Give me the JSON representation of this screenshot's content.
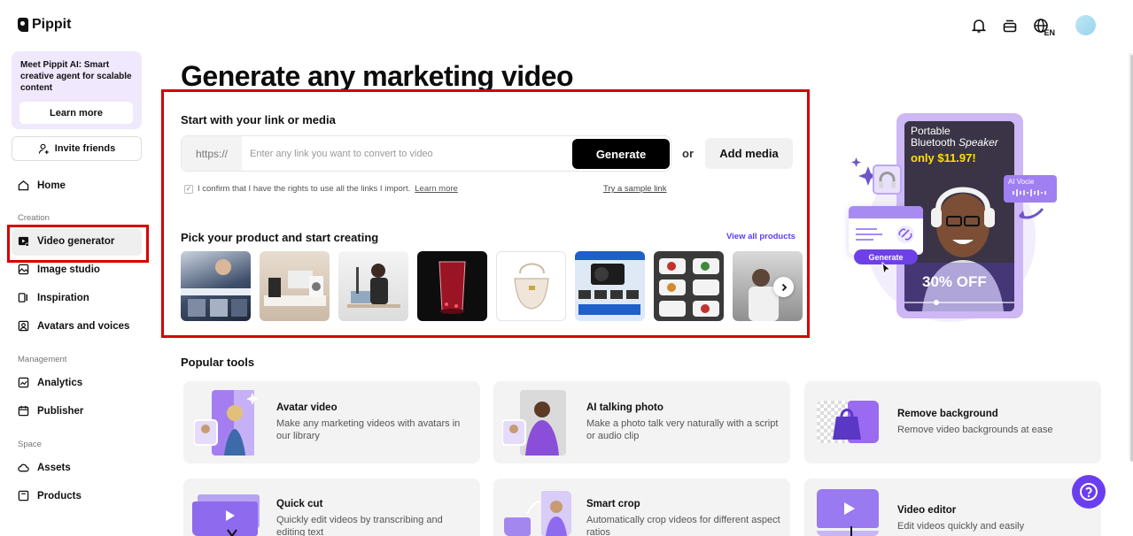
{
  "app": {
    "name": "Pippit"
  },
  "sidebar": {
    "promo_text": "Meet Pippit AI: Smart creative agent for scalable content",
    "promo_button": "Learn more",
    "invite": "Invite friends",
    "home": "Home",
    "section_creation": "Creation",
    "creation_items": [
      "Video generator",
      "Image studio",
      "Inspiration",
      "Avatars and voices"
    ],
    "section_management": "Management",
    "management_items": [
      "Analytics",
      "Publisher"
    ],
    "section_space": "Space",
    "space_items": [
      "Assets",
      "Products"
    ],
    "active_item": "Video generator"
  },
  "header": {
    "lang": "EN",
    "icons": [
      "bell-icon",
      "inbox-icon",
      "globe-icon",
      "user-avatar"
    ]
  },
  "main": {
    "title": "Generate any marketing video",
    "link_section_title": "Start with your link or media",
    "prefix": "https://",
    "link_placeholder": "Enter any link you want to convert to video",
    "generate_label": "Generate",
    "or_label": "or",
    "add_media_label": "Add media",
    "confirm_text": "I confirm that I have the rights to use all the links I import.",
    "learn_more": "Learn more",
    "sample_link": "Try a sample link",
    "products_title": "Pick your product and start creating",
    "view_all": "View all products"
  },
  "hero": {
    "line1": "Portable",
    "line2": "Bluetooth",
    "line2b": "Speaker",
    "price": "only $11.97!",
    "ai_voice": "AI Vocie",
    "generate_pill": "Generate",
    "discount": "30% OFF"
  },
  "tools": {
    "title": "Popular tools",
    "items": [
      {
        "title": "Avatar video",
        "desc": "Make any marketing videos with avatars in our library"
      },
      {
        "title": "AI talking photo",
        "desc": "Make a photo talk very naturally with a script or audio clip"
      },
      {
        "title": "Remove background",
        "desc": "Remove video backgrounds at ease"
      },
      {
        "title": "Quick cut",
        "desc": "Quickly edit videos by transcribing and editing text"
      },
      {
        "title": "Smart crop",
        "desc": "Automatically crop videos for different aspect ratios"
      },
      {
        "title": "Video editor",
        "desc": "Edit videos quickly and easily"
      }
    ]
  },
  "help": "?",
  "colors": {
    "accent": "#6a3ef0",
    "highlight": "#d60000",
    "link": "#5b3df5"
  }
}
